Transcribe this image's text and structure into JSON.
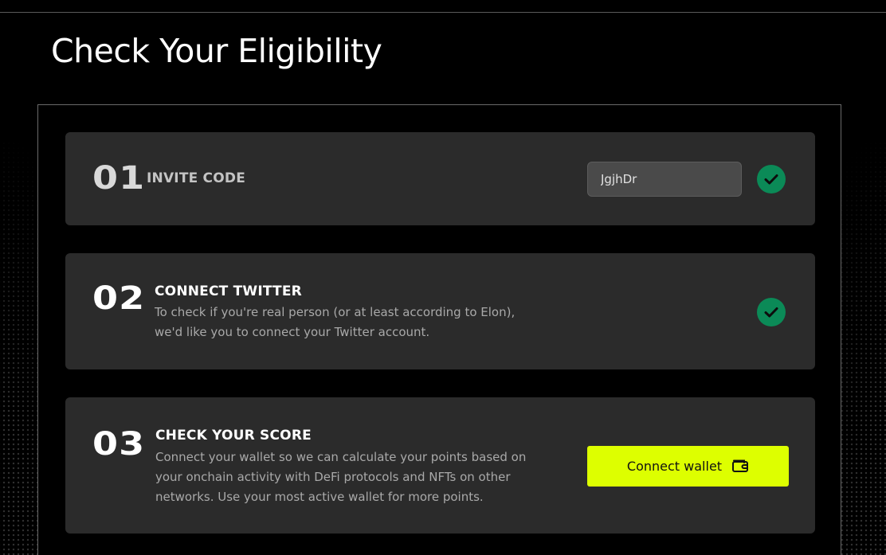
{
  "page": {
    "title": "Check Your Eligibility"
  },
  "steps": [
    {
      "number": "01",
      "label": "INVITE CODE",
      "invite_code_value": "JgjhDr",
      "status_icon": "check-circle-icon",
      "status_color": "#0b8a57"
    },
    {
      "number": "02",
      "label": "CONNECT TWITTER",
      "description": "To check if you're real person (or at least according to Elon), we'd like you to connect your Twitter account.",
      "status_icon": "check-circle-icon",
      "status_color": "#0b8a57"
    },
    {
      "number": "03",
      "label": "CHECK YOUR SCORE",
      "description": "Connect your wallet so we can calculate your points based on your onchain activity with DeFi protocols and NFTs on other networks. Use your most active wallet for more points.",
      "button_label": "Connect wallet",
      "button_icon": "wallet-icon",
      "button_color": "#ddff00"
    }
  ]
}
